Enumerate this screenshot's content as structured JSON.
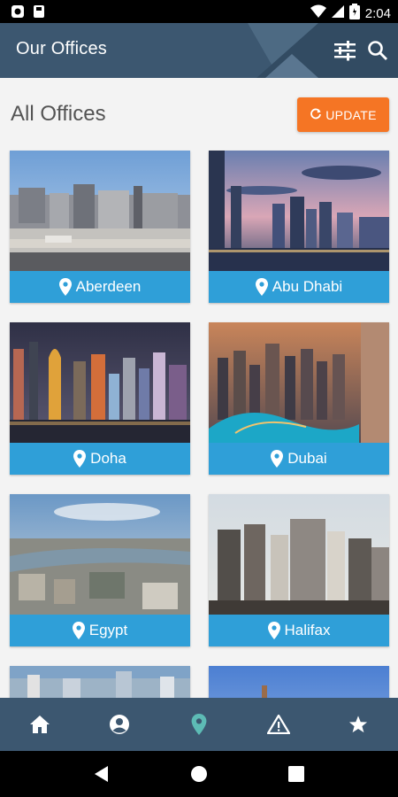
{
  "status_bar": {
    "time": "2:04"
  },
  "app_bar": {
    "title": "Our Offices"
  },
  "section": {
    "title": "All Offices",
    "update_label": "UPDATE"
  },
  "offices": [
    {
      "name": "Aberdeen"
    },
    {
      "name": "Abu Dhabi"
    },
    {
      "name": "Doha"
    },
    {
      "name": "Dubai"
    },
    {
      "name": "Egypt"
    },
    {
      "name": "Halifax"
    },
    {
      "name": ""
    },
    {
      "name": ""
    }
  ],
  "bottom_nav": {
    "items": [
      {
        "icon": "home-icon",
        "active": false
      },
      {
        "icon": "profile-icon",
        "active": false
      },
      {
        "icon": "location-pin-icon",
        "active": true
      },
      {
        "icon": "warning-icon",
        "active": false
      },
      {
        "icon": "star-icon",
        "active": false
      }
    ]
  },
  "colors": {
    "app_bar": "#3c5770",
    "accent": "#f57524",
    "label_bar": "#2f9fd8",
    "active_nav": "#5dbbb5"
  }
}
